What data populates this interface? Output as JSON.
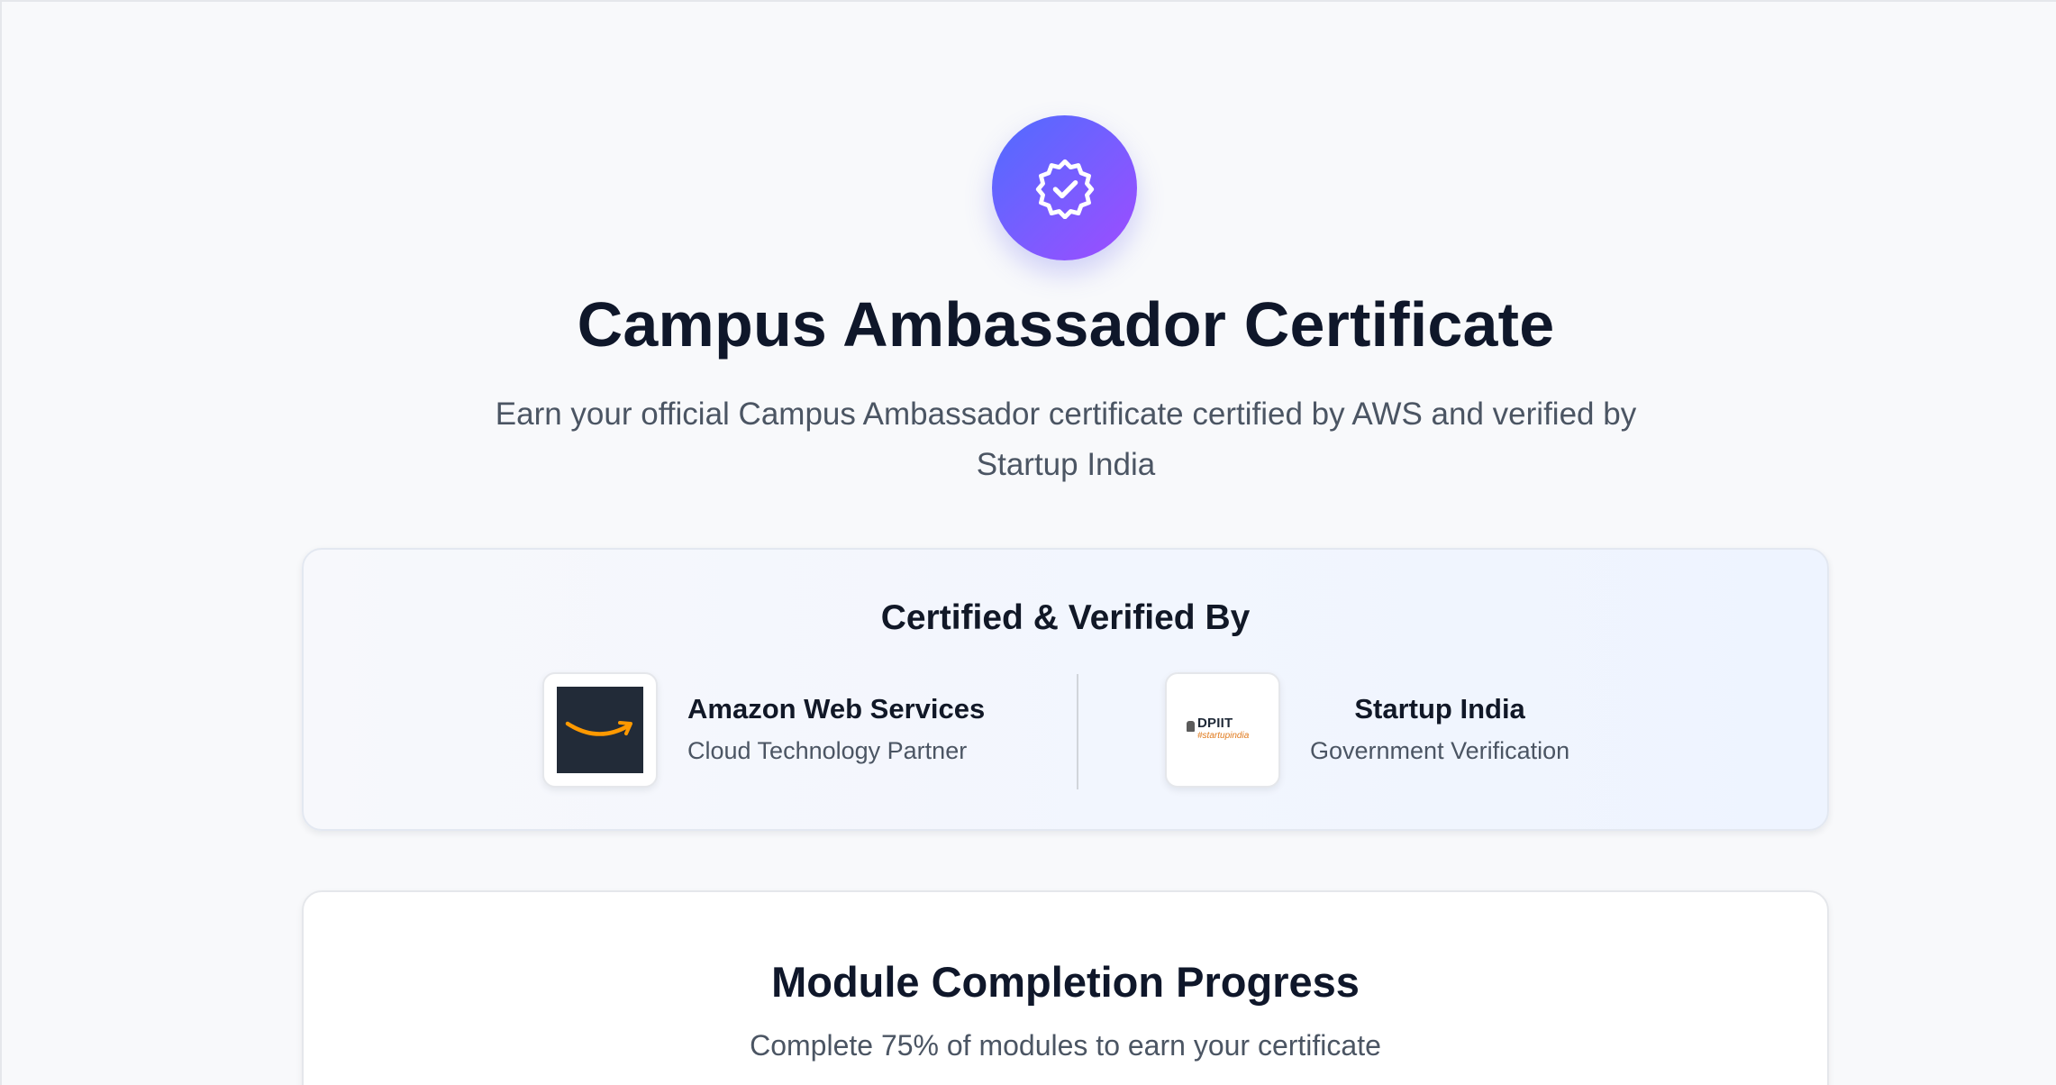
{
  "hero": {
    "icon": "badge-check-icon",
    "title": "Campus Ambassador Certificate",
    "subtitle": "Earn your official Campus Ambassador certificate certified by AWS and verified by Startup India"
  },
  "verification": {
    "title": "Certified & Verified By",
    "partners": [
      {
        "logo": "amazon-logo",
        "name": "Amazon Web Services",
        "description": "Cloud Technology Partner"
      },
      {
        "logo": "startup-india-logo",
        "logo_text": "DPIIT",
        "logo_tagline": "#startupindia",
        "name": "Startup India",
        "description": "Government Verification"
      }
    ]
  },
  "progress": {
    "title": "Module Completion Progress",
    "subtitle": "Complete 75% of modules to earn your certificate"
  },
  "colors": {
    "accent_start": "#4f6cff",
    "accent_end": "#9f4bff",
    "aws_dark": "#222b38",
    "aws_orange": "#ff9900",
    "startup_orange": "#e0791b"
  }
}
